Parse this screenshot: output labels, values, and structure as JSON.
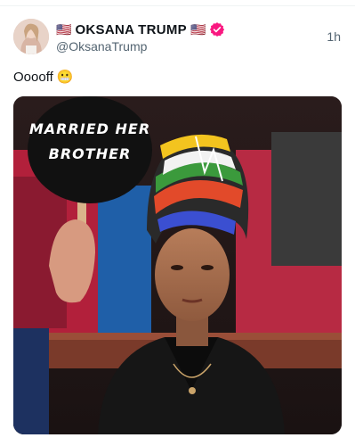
{
  "post": {
    "author": {
      "flag_left": "🇺🇸",
      "display_name": "OKSANA TRUMP",
      "flag_right": "🇺🇸",
      "handle": "@OksanaTrump",
      "verified": true
    },
    "timestamp": "1h",
    "text": "Ooooff",
    "text_emoji": "😬",
    "media": {
      "sign_line1": "MARRIED HER",
      "sign_line2": "BROTHER"
    }
  },
  "colors": {
    "verified_badge": "#f91880",
    "text_primary": "#0f1419",
    "text_secondary": "#536471"
  },
  "icons": {
    "verified": "verified-badge-icon",
    "avatar": "profile-avatar"
  }
}
